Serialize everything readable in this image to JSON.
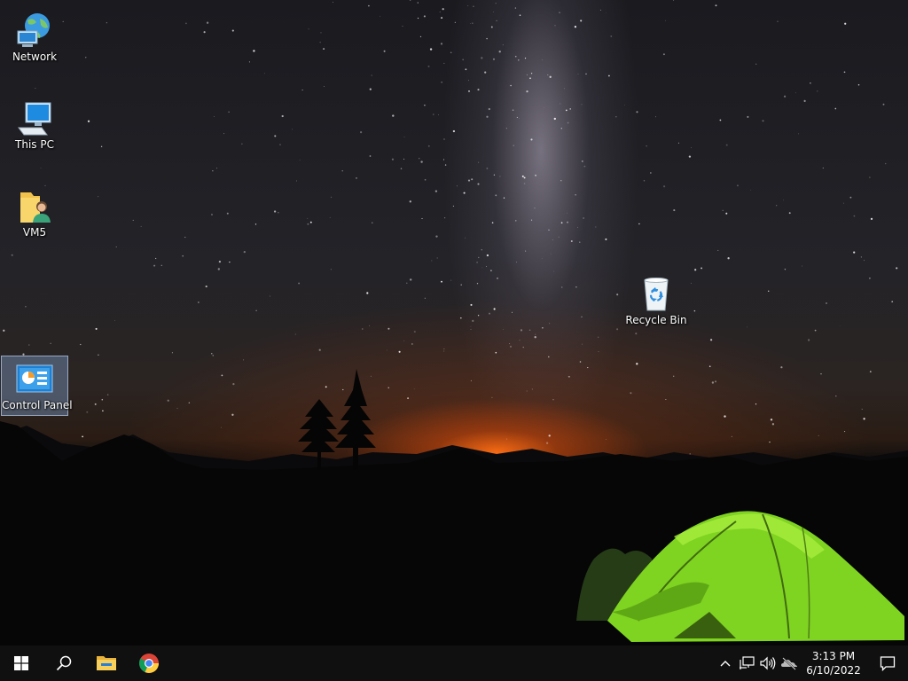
{
  "desktop": {
    "icons": [
      {
        "label": "Network",
        "icon": "network-icon"
      },
      {
        "label": "This PC",
        "icon": "this-pc-icon"
      },
      {
        "label": "VM5",
        "icon": "user-folder-icon"
      },
      {
        "label": "Recycle Bin",
        "icon": "recycle-bin-icon"
      },
      {
        "label": "Control Panel",
        "icon": "control-panel-icon",
        "selected": true
      }
    ]
  },
  "taskbar": {
    "pinned": [
      "start-icon",
      "search-icon",
      "file-explorer-icon",
      "chrome-icon"
    ],
    "tray": [
      "chevron-up-icon",
      "network-tray-icon",
      "volume-icon",
      "onedrive-offline-icon"
    ],
    "clock": {
      "time": "3:13 PM",
      "date": "6/10/2022"
    },
    "notification": "action-center-icon"
  },
  "colors": {
    "taskbar": "#101010",
    "selection": "#7896be",
    "tent": "#7fd321",
    "glow": "#ff6e14"
  }
}
